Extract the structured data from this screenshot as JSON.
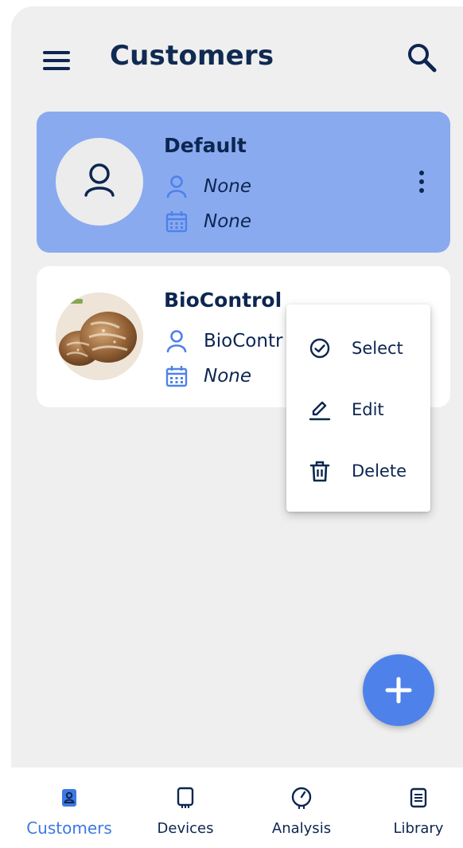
{
  "header": {
    "title": "Customers",
    "menu_icon": "hamburger-menu-icon",
    "search_icon": "search-icon"
  },
  "customers": [
    {
      "name": "Default",
      "contact": "None",
      "date": "None",
      "selected": true,
      "avatar": "person-placeholder-icon"
    },
    {
      "name": "BioControl",
      "contact": "BioContr",
      "date": "None",
      "selected": false,
      "avatar": "bread-photo"
    }
  ],
  "context_menu": {
    "items": [
      {
        "label": "Select",
        "icon": "check-circle-icon"
      },
      {
        "label": "Edit",
        "icon": "pencil-icon"
      },
      {
        "label": "Delete",
        "icon": "trash-icon"
      }
    ]
  },
  "fab": {
    "icon": "plus-icon"
  },
  "bottom_nav": {
    "items": [
      {
        "label": "Customers",
        "icon": "customers-icon",
        "active": true
      },
      {
        "label": "Devices",
        "icon": "device-icon",
        "active": false
      },
      {
        "label": "Analysis",
        "icon": "gauge-icon",
        "active": false
      },
      {
        "label": "Library",
        "icon": "library-icon",
        "active": false
      }
    ]
  },
  "colors": {
    "primary": "#3e78e3",
    "selected_card": "#8aaaf0",
    "text_dark": "#0c2650",
    "fab": "#4e82ea",
    "background": "#efefef"
  }
}
